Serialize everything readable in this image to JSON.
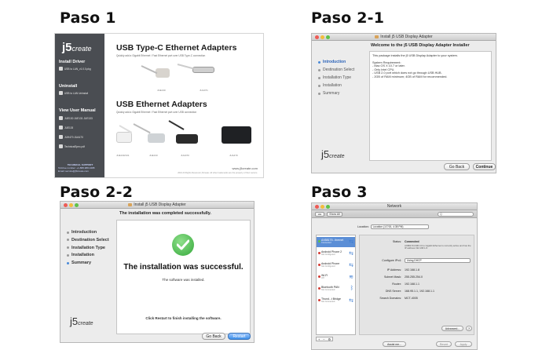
{
  "steps": {
    "s1": "Paso 1",
    "s21": "Paso 2-1",
    "s22": "Paso 2-2",
    "s3": "Paso 3"
  },
  "step1": {
    "logo_main": "j5",
    "logo_sub": "create",
    "install_driver": "Install Driver",
    "install_driver_item": "USB to LAN_v1.0.0.pkg",
    "uninstall": "Uninstall",
    "uninstall_item": "USB to LAN Uninstall",
    "view_manual": "View User Manual",
    "manuals": [
      "JUE130 JUE131 JUE133",
      "JUE135",
      "JUH470 JUA470",
      "TechnicalSpec.pdf"
    ],
    "support": "TECHNICAL SUPPORT",
    "support_phone": "Toll-free number: +1-888-988-0488",
    "support_email": "Email: service@j5create.com",
    "heading1": "USB Type-C Ethernet Adapters",
    "sub1": "Quickly add a Gigabit Ethernet / Fast Ethernet port over USB Type-C connection",
    "heading2": "USB Ethernet Adapters",
    "sub2": "Quickly add a Gigabit Ethernet / Fast Ethernet port over USB connection",
    "models_top": [
      "JUE130",
      "JUH471"
    ],
    "models_bottom": [
      "JUE130/131",
      "JUE133",
      "JUH470",
      "JUA470"
    ],
    "website": "www.j5create.com",
    "legal": "2016 All Rights Reserved. j5create. All other trademarks are the property of their owners."
  },
  "step21": {
    "title": "Install j5 USB Display Adapter",
    "heading": "Welcome to the j5 USB Display Adapter Installer",
    "body_lines": [
      "This package installs the j5 USB Display Adapter to your system.",
      "",
      "System Requirement:",
      "- Mac OS X 10.7 or later.",
      "- Only Intel CPU.",
      "- USB 2.0 port which does not go through USB HUB.",
      "- 2GB of RAM minimum; 4GB of RAM for recommended."
    ],
    "steps": [
      "Introduction",
      "Destination Select",
      "Installation Type",
      "Installation",
      "Summary"
    ],
    "logo": "j5",
    "logo_sub": "create",
    "btn_back": "Go Back",
    "btn_continue": "Continue"
  },
  "step22": {
    "title": "Install j5 USB Display Adapter",
    "heading": "The installation was completed successfully.",
    "steps": [
      "Introduction",
      "Destination Select",
      "Installation Type",
      "Installation",
      "Summary"
    ],
    "big": "The installation was successful.",
    "small": "The software was installed.",
    "foot": "Click Restart to finish installing the software.",
    "logo": "j5",
    "logo_sub": "create",
    "btn_back": "Go Back",
    "btn_restart": "Restart"
  },
  "step3": {
    "title": "Network",
    "show_all": "Show All",
    "search_placeholder": "Q",
    "location_label": "Location:",
    "location_value": "Location (1/7/15, 4:38 PM)",
    "interfaces": [
      {
        "name": "AX88179...thernet",
        "status": "Connected"
      },
      {
        "name": "Android Phone 2",
        "status": "Not Configured"
      },
      {
        "name": "Android Phone",
        "status": "Not Configured"
      },
      {
        "name": "Wi-Fi",
        "status": "Off"
      },
      {
        "name": "Bluetooth PAN",
        "status": "Not Connected"
      },
      {
        "name": "Thund...t Bridge",
        "status": "Not Connected"
      }
    ],
    "status_label": "Status:",
    "status_value": "Connected",
    "status_note": "AX88179 USB 3.0 to Gigabit Ethernet is currently active and has the IP address 192.168.1.8.",
    "configure_label": "Configure IPv4:",
    "configure_value": "Using DHCP",
    "ip_label": "IP Address:",
    "ip_value": "192.168.1.8",
    "mask_label": "Subnet Mask:",
    "mask_value": "255.255.254.0",
    "router_label": "Router:",
    "router_value": "192.168.1.1",
    "dns_label": "DNS Server:",
    "dns_value": "168.95.1.1, 192.168.1.1",
    "search_label": "Search Domains:",
    "search_value": "MCT-4005",
    "advanced": "Advanced...",
    "help": "?",
    "assist": "Assist me...",
    "revert": "Revert",
    "apply": "Apply"
  },
  "colors": {
    "sidebar": "#4a4d52",
    "accent_blue": "#3d8fe8",
    "check_green": "#34a83a"
  }
}
